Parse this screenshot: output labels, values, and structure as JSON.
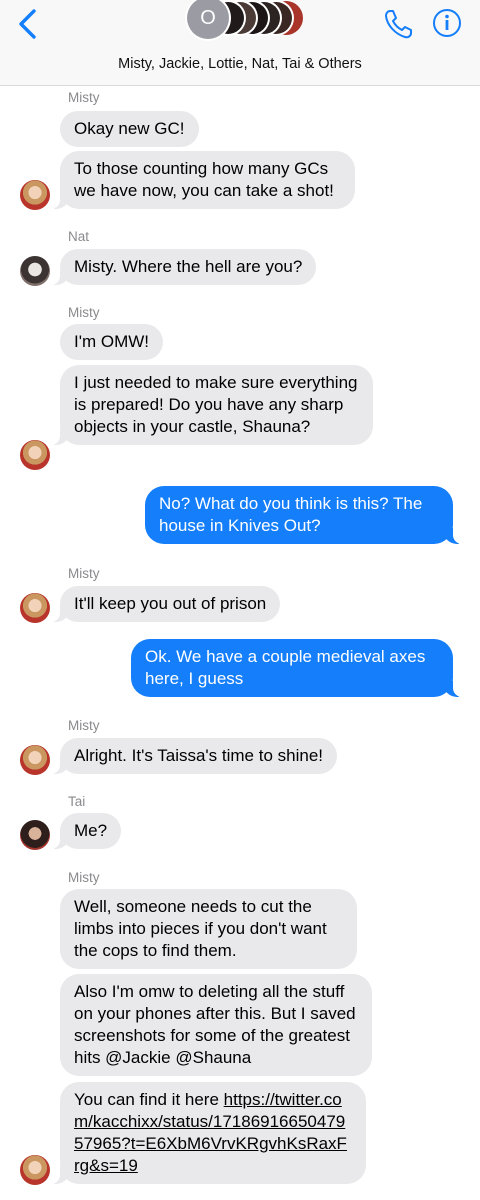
{
  "header": {
    "group_title": "Misty, Jackie, Lottie, Nat, Tai & Others",
    "avatar_initial": "O"
  },
  "colors": {
    "accent": "#147efb",
    "incoming_bubble": "#e9e9eb"
  },
  "messages": [
    {
      "sender": "Misty",
      "text": "Okay new GC!"
    },
    {
      "text": "To those counting how many GCs we have now, you can take a shot!"
    },
    {
      "sender": "Nat",
      "text": "Misty. Where the hell are you?"
    },
    {
      "sender": "Misty",
      "text": "I'm OMW!"
    },
    {
      "text": "I just needed to make sure everything is prepared! Do you have any sharp objects in your castle, Shauna?"
    },
    {
      "text": "No? What do you think is this? The house in Knives Out?"
    },
    {
      "sender": "Misty",
      "text": "It'll keep you out of prison"
    },
    {
      "text": "Ok. We have a couple medieval axes here, I guess"
    },
    {
      "sender": "Misty",
      "text": "Alright. It's Taissa's time to shine!"
    },
    {
      "sender": "Tai",
      "text": "Me?"
    },
    {
      "sender": "Misty",
      "text": "Well, someone needs to cut the limbs into pieces if you don't want the cops to find them."
    },
    {
      "text": "Also I'm omw to deleting all the stuff on your phones after this. But I saved screenshots for some of the greatest hits @Jackie @Shauna"
    },
    {
      "text_prefix": "You can find it here ",
      "link": "https://twitter.com/kacchixx/status/1718691665047957965?t=E6XbM6VrvKRgvhKsRaxFrg&s=19"
    }
  ]
}
